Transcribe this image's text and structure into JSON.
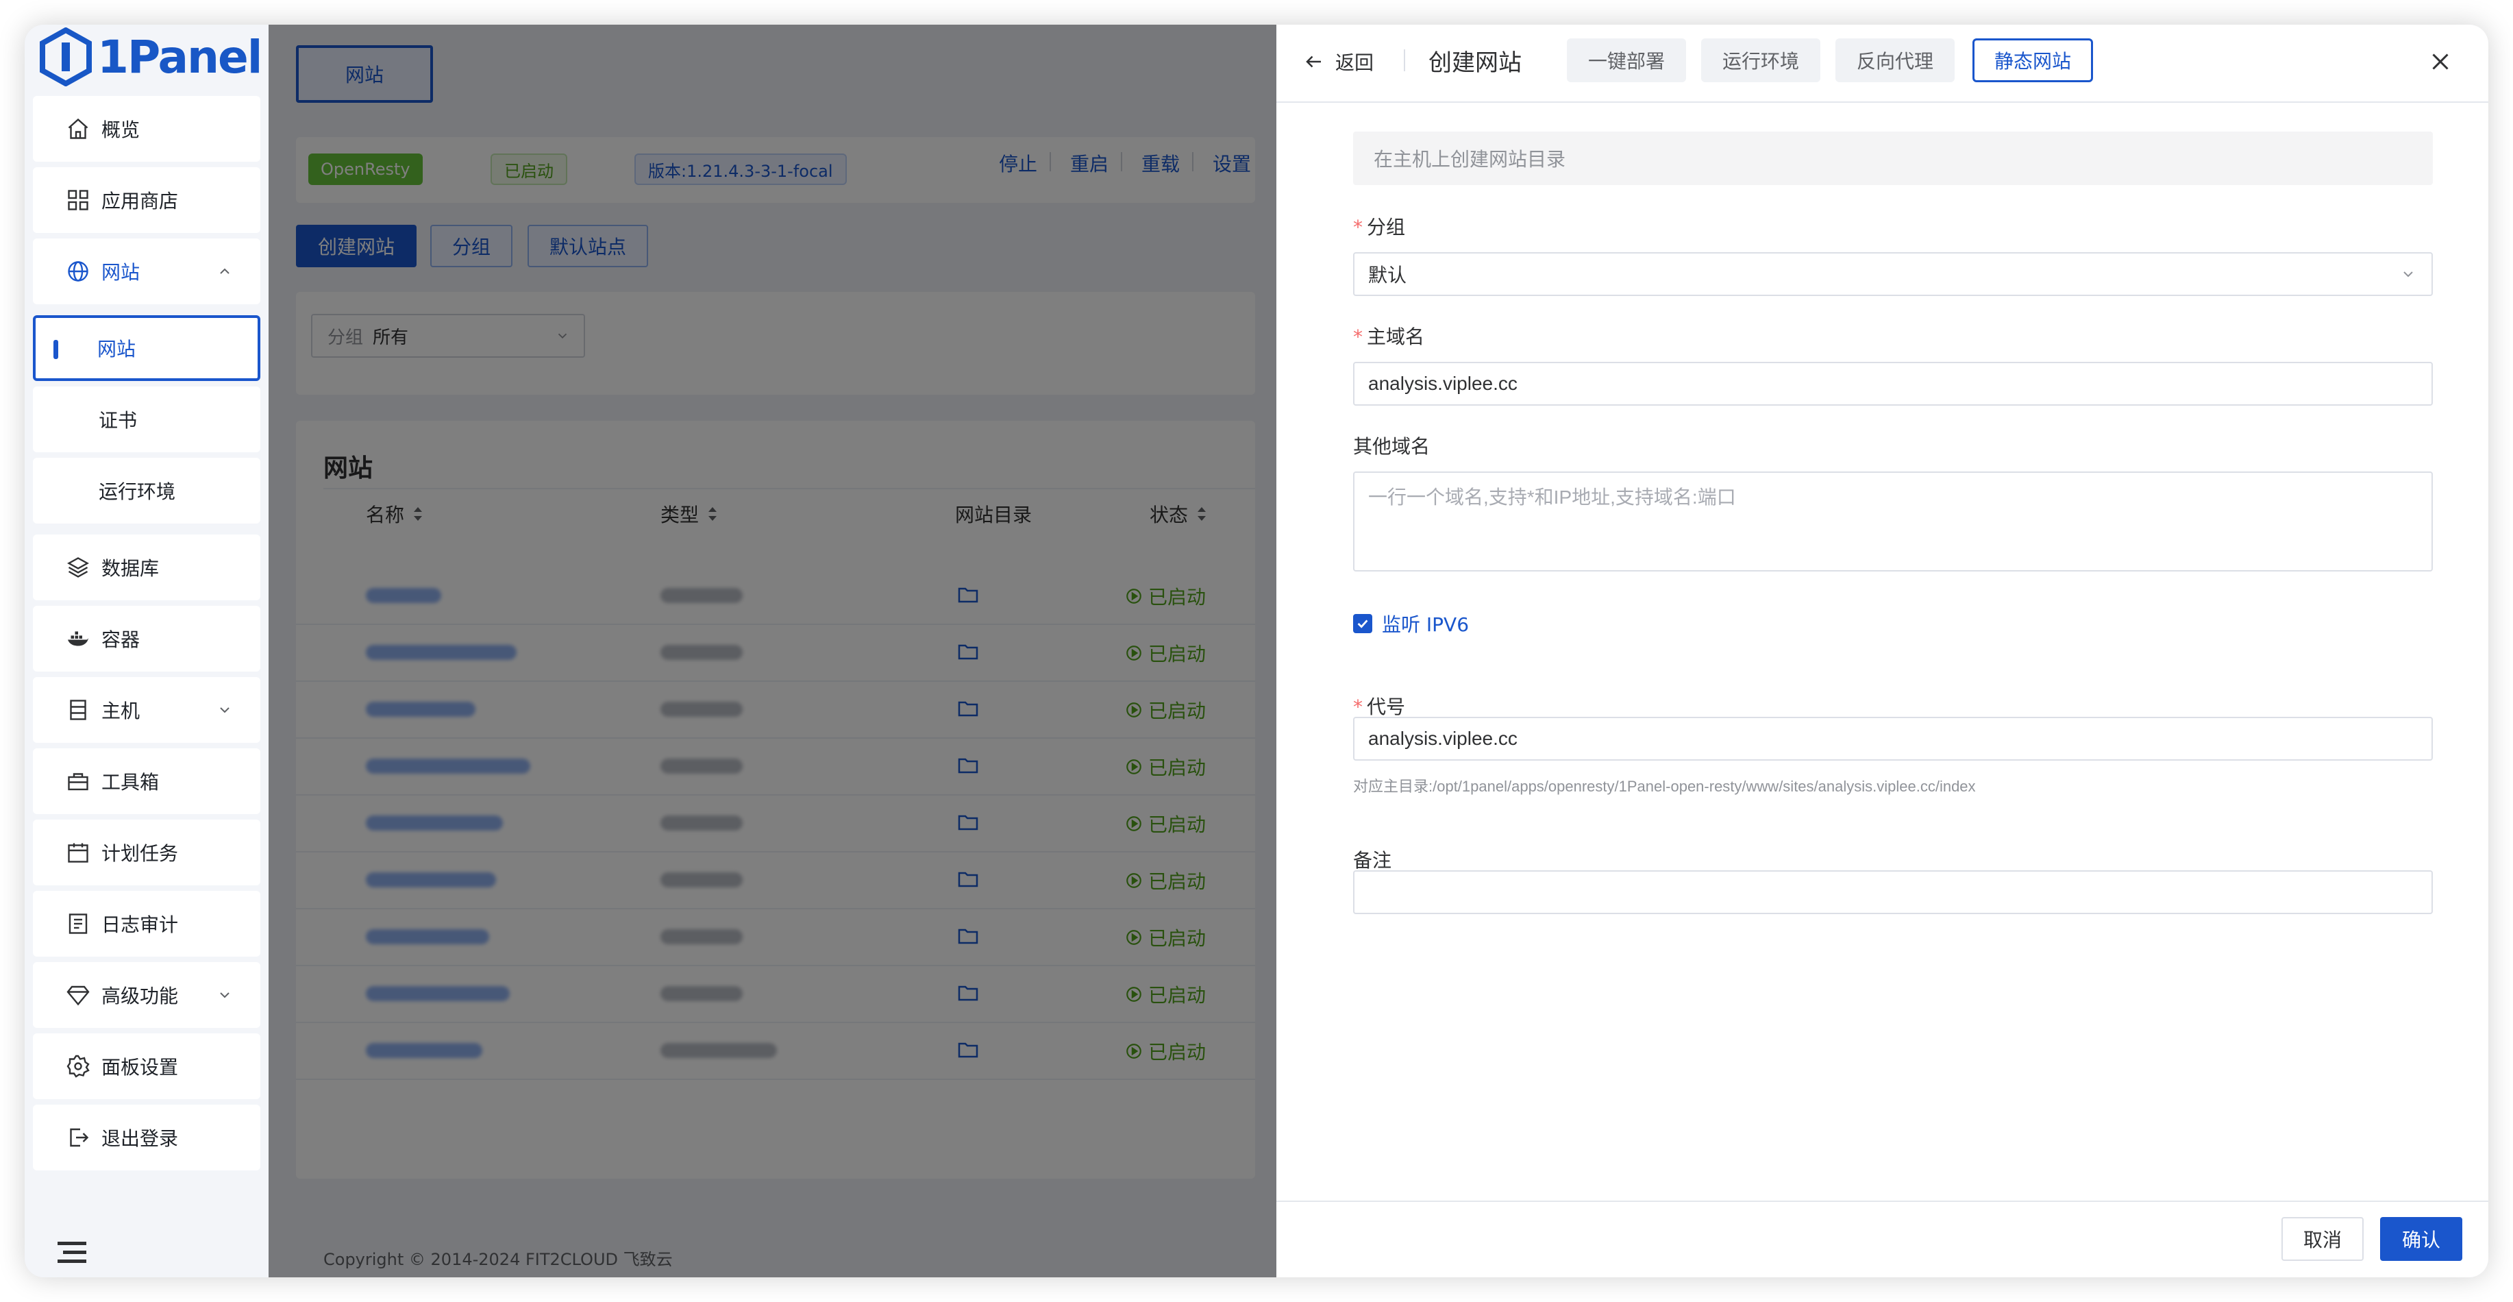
{
  "app": {
    "logo_text": "1Panel"
  },
  "sidebar": {
    "items": [
      {
        "label": "概览",
        "icon": "home-icon"
      },
      {
        "label": "应用商店",
        "icon": "apps-grid-icon"
      },
      {
        "label": "网站",
        "icon": "globe-icon",
        "expanded": true
      },
      {
        "label": "网站",
        "sub": true,
        "active": true
      },
      {
        "label": "证书",
        "sub": true
      },
      {
        "label": "运行环境",
        "sub": true
      },
      {
        "label": "数据库",
        "icon": "layers-icon"
      },
      {
        "label": "容器",
        "icon": "docker-icon"
      },
      {
        "label": "主机",
        "icon": "server-icon",
        "expandable": true
      },
      {
        "label": "工具箱",
        "icon": "toolbox-icon"
      },
      {
        "label": "计划任务",
        "icon": "calendar-icon"
      },
      {
        "label": "日志审计",
        "icon": "log-icon"
      },
      {
        "label": "高级功能",
        "icon": "diamond-icon",
        "expandable": true
      },
      {
        "label": "面板设置",
        "icon": "gear-icon"
      },
      {
        "label": "退出登录",
        "icon": "logout-icon"
      }
    ]
  },
  "main": {
    "tab_label": "网站",
    "openresty": {
      "app_tag": "OpenResty",
      "status_tag": "已启动",
      "version_tag": "版本:1.21.4.3-3-1-focal",
      "actions": [
        "停止",
        "重启",
        "重载",
        "设置"
      ]
    },
    "buttons": {
      "create": "创建网站",
      "group": "分组",
      "default_site": "默认站点"
    },
    "filter": {
      "label": "分组",
      "value": "所有"
    },
    "list_title": "网站",
    "columns": [
      "名称",
      "类型",
      "网站目录",
      "状态"
    ],
    "row_status": "已启动",
    "row_count": 9,
    "footer": "Copyright © 2014-2024 FIT2CLOUD 飞致云"
  },
  "drawer": {
    "back": "返回",
    "title": "创建网站",
    "tabs": [
      "一键部署",
      "运行环境",
      "反向代理",
      "静态网站"
    ],
    "active_tab": 3,
    "hint_text": "在主机上创建网站目录",
    "group_label": "分组",
    "group_value": "默认",
    "primary_domain_label": "主域名",
    "primary_domain_value": "analysis.viplee.cc",
    "other_domains_label": "其他域名",
    "other_domains_placeholder": "一行一个域名,支持*和IP地址,支持域名:端口",
    "ipv6_label": "监听 IPV6",
    "ipv6_checked": true,
    "alias_label": "代号",
    "alias_value": "analysis.viplee.cc",
    "dir_hint": "对应主目录:/opt/1panel/apps/openresty/1Panel-open-resty/www/sites/analysis.viplee.cc/index",
    "remark_label": "备注",
    "remark_value": "",
    "cancel": "取消",
    "confirm": "确认"
  },
  "colors": {
    "primary": "#1a56cc",
    "success": "#52a31c",
    "required": "#f56c6c"
  }
}
